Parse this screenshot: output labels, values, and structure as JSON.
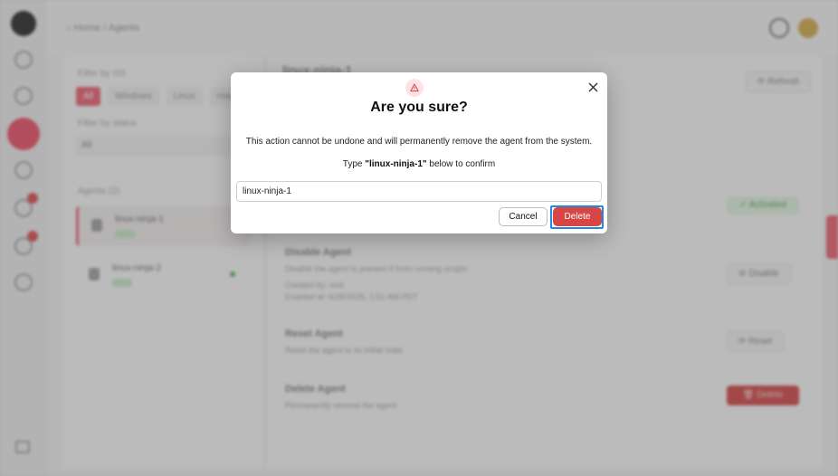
{
  "background": {
    "breadcrumb": "⌂ Home / Agents",
    "filter_os_label": "Filter by OS",
    "os_tabs": [
      "All",
      "Windows",
      "Linux",
      "macOS"
    ],
    "filter_status_label": "Filter by status",
    "status_select": "All",
    "agents_label": "Agents (2)",
    "agents": [
      {
        "name": "linux-ninja-1",
        "status": "ON"
      },
      {
        "name": "linux-ninja-2",
        "status": "ON"
      }
    ],
    "agent_title": "linux-ninja-1",
    "refresh_label": "⟳ Refresh",
    "status_badge": "✓ Activated",
    "disable_title": "Disable Agent",
    "disable_desc": "Disable the agent to prevent it from running scripts",
    "created_by": "Created by: root",
    "enabled_at": "Enabled at: 6/28/2025, 1:51 AM PDT",
    "disable_btn": "⊘ Disable",
    "reset_title": "Reset Agent",
    "reset_desc": "Reset the agent to its initial state",
    "reset_btn": "⟳ Reset",
    "delete_title": "Delete Agent",
    "delete_desc": "Permanently remove the agent",
    "delete_btn": "🗑 Delete"
  },
  "modal": {
    "icon": "warning-triangle-icon",
    "title": "Are you sure?",
    "body": "This action cannot be undone and will permanently remove the agent from the system.",
    "confirm_prefix": "Type ",
    "confirm_name": "\"linux-ninja-1\"",
    "confirm_suffix": " below to confirm",
    "input_value": "linux-ninja-1",
    "cancel_label": "Cancel",
    "delete_label": "Delete"
  },
  "colors": {
    "accent": "#e05a6a",
    "danger": "#d84545",
    "focus": "#1e88e5"
  }
}
